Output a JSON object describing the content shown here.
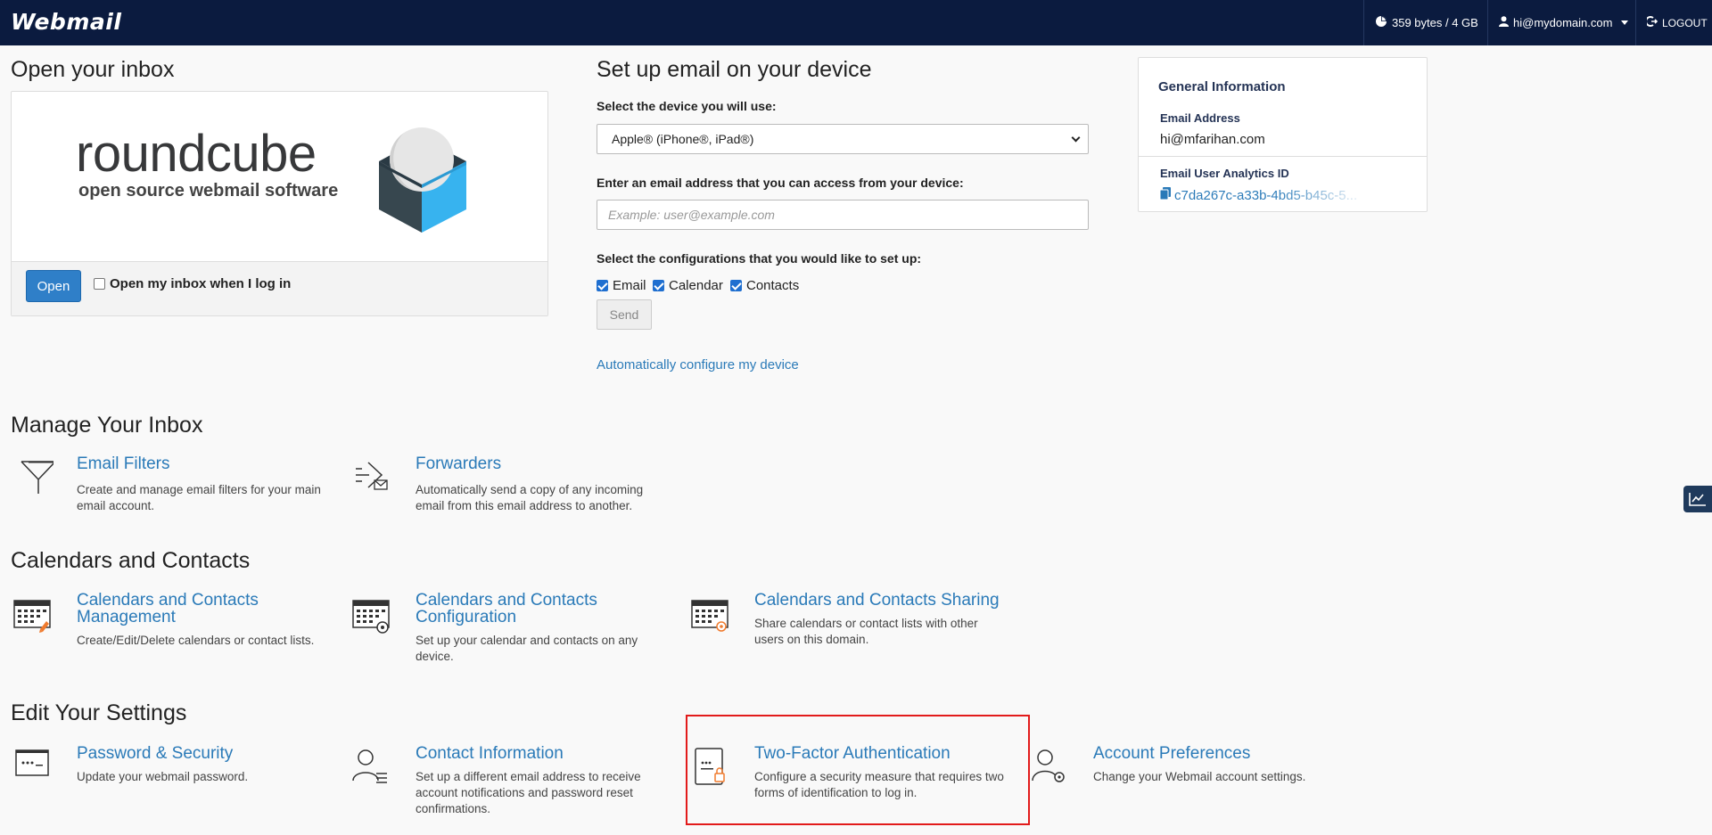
{
  "header": {
    "brand": "Webmail",
    "disk_usage": "359 bytes / 4 GB",
    "user": "hi@mydomain.com",
    "logout": "LOGOUT"
  },
  "inbox": {
    "heading": "Open your inbox",
    "logo_word": "roundcube",
    "logo_tagline": "open source webmail software",
    "open_button": "Open",
    "auto_open_label": "Open my inbox when I log in",
    "auto_open_checked": false
  },
  "setup": {
    "heading": "Set up email on your device",
    "device_label": "Select the device you will use:",
    "device_selected": "Apple® (iPhone®, iPad®)",
    "email_label": "Enter an email address that you can access from your device:",
    "email_placeholder": "Example: user@example.com",
    "config_label": "Select the configurations that you would like to set up:",
    "configs": [
      {
        "label": "Email",
        "checked": true
      },
      {
        "label": "Calendar",
        "checked": true
      },
      {
        "label": "Contacts",
        "checked": true
      }
    ],
    "send_button": "Send",
    "auto_config_link": "Automatically configure my device"
  },
  "general_info": {
    "title": "General Information",
    "email_label": "Email Address",
    "email_value": "hi@mfarihan.com",
    "analytics_label": "Email User Analytics ID",
    "analytics_value": "c7da267c-a33b-4bd5-b45c-5..."
  },
  "sections": {
    "manage": {
      "heading": "Manage Your Inbox",
      "items": [
        {
          "title": "Email Filters",
          "desc": "Create and manage email filters for your main email account."
        },
        {
          "title": "Forwarders",
          "desc": "Automatically send a copy of any incoming email from this email address to another."
        }
      ]
    },
    "calendars": {
      "heading": "Calendars and Contacts",
      "items": [
        {
          "title": "Calendars and Contacts Management",
          "desc": "Create/Edit/Delete calendars or contact lists."
        },
        {
          "title": "Calendars and Contacts Configuration",
          "desc": "Set up your calendar and contacts on any device."
        },
        {
          "title": "Calendars and Contacts Sharing",
          "desc": "Share calendars or contact lists with other users on this domain."
        }
      ]
    },
    "settings": {
      "heading": "Edit Your Settings",
      "items": [
        {
          "title": "Password & Security",
          "desc": "Update your webmail password."
        },
        {
          "title": "Contact Information",
          "desc": "Set up a different email address to receive account notifications and password reset confirmations."
        },
        {
          "title": "Two-Factor Authentication",
          "desc": "Configure a security measure that requires two forms of identification to log in."
        },
        {
          "title": "Account Preferences",
          "desc": "Change your Webmail account settings."
        }
      ]
    }
  },
  "colors": {
    "topbar": "#0b1b3f",
    "link": "#2a7ab8",
    "primary_button": "#2f7fc8",
    "highlight_border": "#e21b1b"
  },
  "icons": [
    "disk-usage-pie-icon",
    "user-icon",
    "logout-icon",
    "copy-icon",
    "filter-icon",
    "forward-icon",
    "calendar-edit-icon",
    "calendar-config-icon",
    "calendar-share-icon",
    "password-icon",
    "contact-info-icon",
    "two-factor-icon",
    "account-preferences-icon",
    "analytics-chart-icon"
  ]
}
